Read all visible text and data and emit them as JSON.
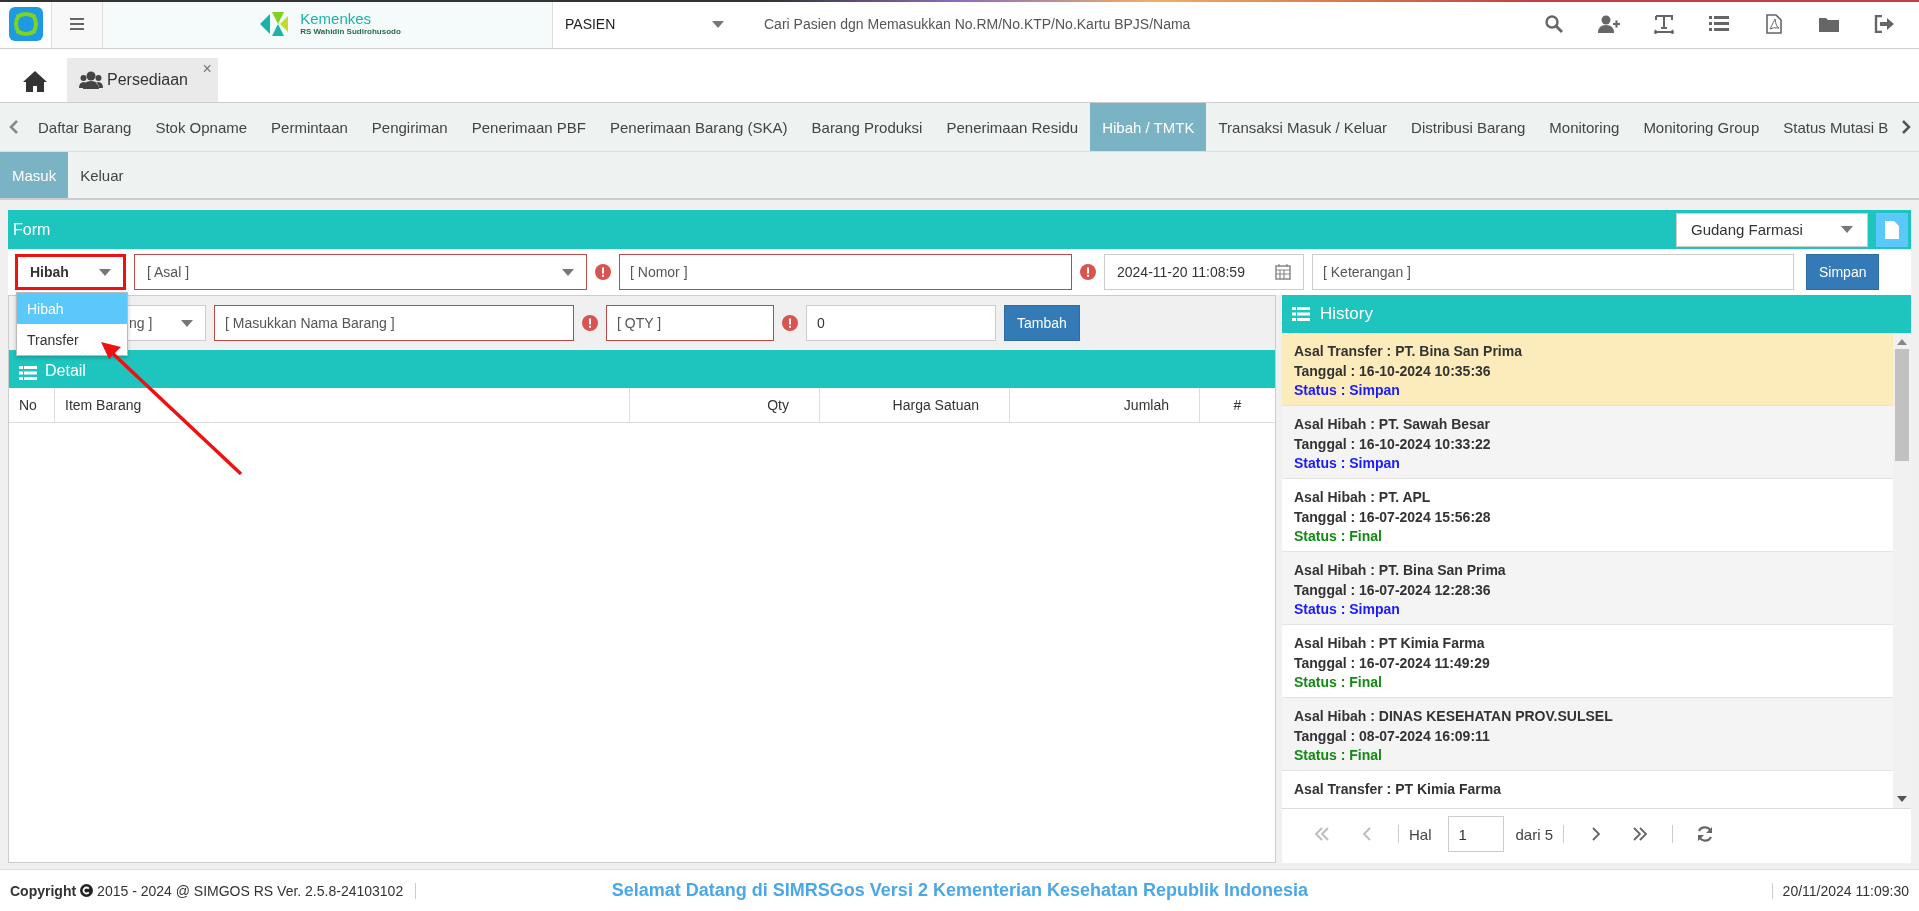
{
  "topbar": {
    "logo_title": "Kemenkes",
    "logo_subtitle": "RS Wahidin Sudirohusodo",
    "module": "PASIEN",
    "search_placeholder": "Cari Pasien dgn Memasukkan No.RM/No.KTP/No.Kartu BPJS/Nama"
  },
  "window_tabs": [
    {
      "label": "Persediaan",
      "selected": true,
      "close": "×"
    }
  ],
  "menu": [
    {
      "label": "Daftar Barang",
      "selected": false
    },
    {
      "label": "Stok Opname",
      "selected": false
    },
    {
      "label": "Permintaan",
      "selected": false
    },
    {
      "label": "Pengiriman",
      "selected": false
    },
    {
      "label": "Penerimaan PBF",
      "selected": false
    },
    {
      "label": "Penerimaan Barang (SKA)",
      "selected": false
    },
    {
      "label": "Barang Produksi",
      "selected": false
    },
    {
      "label": "Penerimaan Residu",
      "selected": false
    },
    {
      "label": "Hibah / TMTK",
      "selected": true
    },
    {
      "label": "Transaksi Masuk / Keluar",
      "selected": false
    },
    {
      "label": "Distribusi Barang",
      "selected": false
    },
    {
      "label": "Monitoring",
      "selected": false
    },
    {
      "label": "Monitoring Group",
      "selected": false
    },
    {
      "label": "Status Mutasi B",
      "selected": false
    }
  ],
  "subtabs": [
    {
      "label": "Masuk",
      "selected": true
    },
    {
      "label": "Keluar",
      "selected": false
    }
  ],
  "form": {
    "title": "Form",
    "warehouse": "Gudang Farmasi",
    "type_select": {
      "value": "Hibah",
      "highlighted": true,
      "expanded": true,
      "options": [
        {
          "label": "Hibah",
          "selected": true
        },
        {
          "label": "Transfer",
          "selected": false
        }
      ]
    },
    "asal": {
      "placeholder": "[ Asal ]",
      "required": true
    },
    "nomor": {
      "placeholder": "[ Nomor ]",
      "required": true
    },
    "tanggal": "2024-11-20 11:08:59",
    "keterangan": {
      "placeholder": "[ Keterangan ]",
      "required": false
    },
    "save": "Simpan"
  },
  "item_row": {
    "unit_select": "ng ]",
    "name": {
      "placeholder": "[ Masukkan Nama Barang ]",
      "required": true
    },
    "qty": {
      "placeholder": "[ QTY ]",
      "required": true
    },
    "price": "0",
    "add": "Tambah"
  },
  "detail": {
    "title": "Detail",
    "columns": [
      "No",
      "Item Barang",
      "Qty",
      "Harga Satuan",
      "Jumlah",
      "#"
    ]
  },
  "history": {
    "title": "History",
    "items": [
      {
        "asal": "Asal Transfer : PT. Bina San Prima",
        "tanggal": "Tanggal : 16-10-2024 10:35:36",
        "status": "Status : Simpan",
        "color": "#1a1aff",
        "selected": true
      },
      {
        "asal": "Asal Hibah : PT. Sawah Besar",
        "tanggal": "Tanggal : 16-10-2024 10:33:22",
        "status": "Status : Simpan",
        "color": "#1a1aff",
        "selected": false
      },
      {
        "asal": "Asal Hibah : PT. APL",
        "tanggal": "Tanggal : 16-07-2024 15:56:28",
        "status": "Status : Final",
        "color": "#138a13",
        "selected": false
      },
      {
        "asal": "Asal Hibah : PT. Bina San Prima",
        "tanggal": "Tanggal : 16-07-2024 12:28:36",
        "status": "Status : Simpan",
        "color": "#1a1aff",
        "selected": false
      },
      {
        "asal": "Asal Hibah : PT Kimia Farma",
        "tanggal": "Tanggal : 16-07-2024 11:49:29",
        "status": "Status : Final",
        "color": "#138a13",
        "selected": false
      },
      {
        "asal": "Asal Hibah : DINAS KESEHATAN PROV.SULSEL",
        "tanggal": "Tanggal : 08-07-2024 16:09:11",
        "status": "Status : Final",
        "color": "#138a13",
        "selected": false
      },
      {
        "asal": "Asal Transfer : PT Kimia Farma",
        "selected": false
      }
    ],
    "pager": {
      "label": "Hal",
      "page": "1",
      "total": "dari 5"
    }
  },
  "footer": {
    "copyright": "Copyright",
    "version": "2015 - 2024 @ SIMGOS RS Ver. 2.5.8-24103102",
    "welcome": "Selamat Datang di SIMRSGos Versi 2 Kementerian Kesehatan Republik Indonesia",
    "datetime": "20/11/2024 11:09:30"
  }
}
